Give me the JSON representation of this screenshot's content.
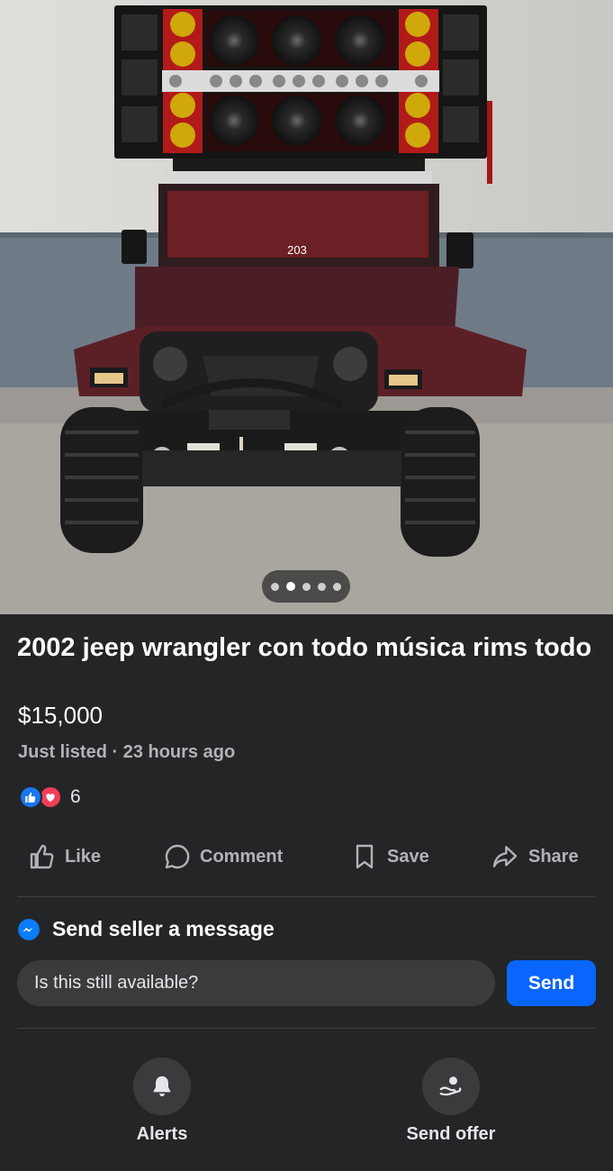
{
  "photo": {
    "alt": "Jeep with speaker box",
    "windshield_decal": "203",
    "carousel": {
      "count": 5,
      "active_index": 1
    }
  },
  "listing": {
    "title": "2002 jeep wrangler con todo música rims todo",
    "price": "$15,000",
    "listed": "Just listed · 23 hours ago",
    "reaction_count": "6"
  },
  "actions": {
    "like": "Like",
    "comment": "Comment",
    "save": "Save",
    "share": "Share"
  },
  "message": {
    "title": "Send seller a message",
    "input_value": "Is this still available?",
    "send": "Send"
  },
  "bottom": {
    "alerts": "Alerts",
    "send_offer": "Send offer"
  },
  "colors": {
    "background": "#242526",
    "accent": "#0866ff",
    "secondary_text": "#b0b3b8",
    "like": "#1877f2",
    "love": "#f33e58"
  },
  "icons": [
    "like-reaction-icon",
    "love-reaction-icon",
    "thumbs-up-icon",
    "comment-icon",
    "bookmark-icon",
    "share-icon",
    "messenger-icon",
    "bell-icon",
    "send-offer-icon"
  ]
}
